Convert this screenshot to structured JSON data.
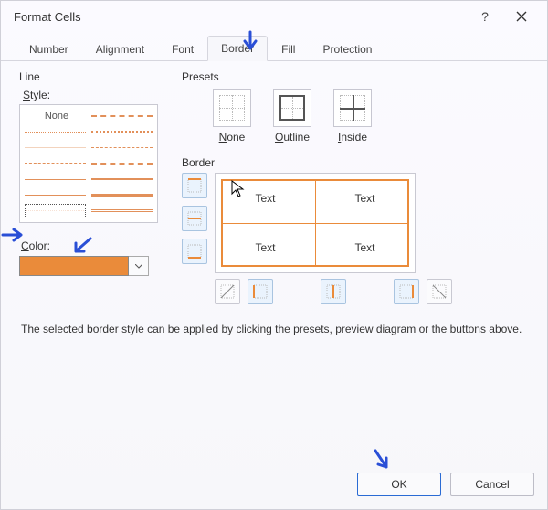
{
  "window": {
    "title": "Format Cells",
    "help": "?",
    "close": "×"
  },
  "tabs": {
    "number": "Number",
    "alignment": "Alignment",
    "font": "Font",
    "border": "Border",
    "fill": "Fill",
    "protection": "Protection"
  },
  "line": {
    "group": "Line",
    "style_label": "Style:",
    "none": "None"
  },
  "color": {
    "label": "Color:",
    "value": "#ea8b3a"
  },
  "presets": {
    "group": "Presets",
    "none": "None",
    "outline": "Outline",
    "inside": "Inside"
  },
  "border_group": "Border",
  "preview": {
    "text": "Text"
  },
  "hint": "The selected border style can be applied by clicking the presets, preview diagram or the buttons above.",
  "buttons": {
    "ok": "OK",
    "cancel": "Cancel"
  }
}
